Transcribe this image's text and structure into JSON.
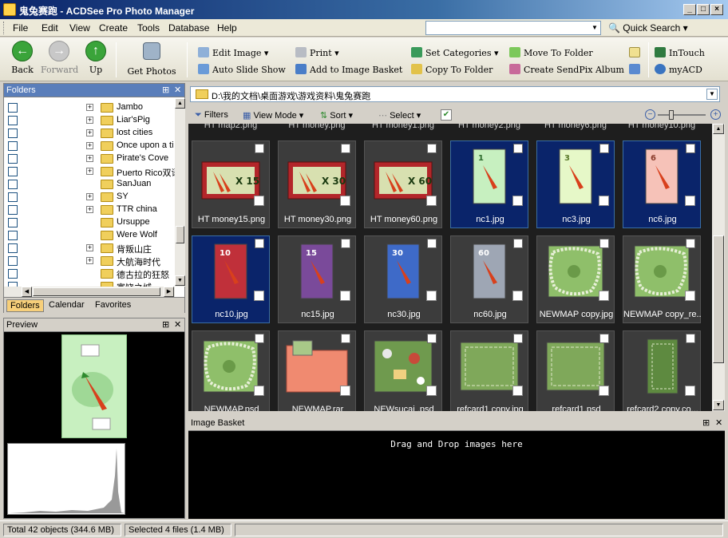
{
  "window": {
    "title": "鬼兔赛跑 - ACDSee Pro Photo Manager"
  },
  "menu": {
    "items": [
      "File",
      "Edit",
      "View",
      "Create",
      "Tools",
      "Database",
      "Help"
    ],
    "quick_search": "Quick Search"
  },
  "toolbar": {
    "back": "Back",
    "forward": "Forward",
    "up": "Up",
    "get_photos": "Get Photos",
    "edit_image": "Edit Image",
    "auto_slide_show": "Auto Slide Show",
    "print": "Print",
    "add_to_basket": "Add to Image Basket",
    "set_categories": "Set Categories",
    "copy_to_folder": "Copy To Folder",
    "move_to_folder": "Move To Folder",
    "create_sendpix": "Create SendPix Album",
    "intouch": "InTouch",
    "myacd": "myACD"
  },
  "folders": {
    "title": "Folders",
    "items": [
      {
        "name": "Jambo",
        "expander": true
      },
      {
        "name": "Liar'sPig",
        "expander": true
      },
      {
        "name": "lost cities",
        "expander": true
      },
      {
        "name": "Once upon a ti",
        "expander": true
      },
      {
        "name": "Pirate's Cove",
        "expander": true
      },
      {
        "name": "Puerto Rico双语",
        "expander": true
      },
      {
        "name": "SanJuan",
        "expander": false
      },
      {
        "name": "SY",
        "expander": true
      },
      {
        "name": "TTR china",
        "expander": true
      },
      {
        "name": "Ursuppe",
        "expander": false
      },
      {
        "name": "Were Wolf",
        "expander": false
      },
      {
        "name": "背叛山庄",
        "expander": true
      },
      {
        "name": "大航海时代",
        "expander": true
      },
      {
        "name": "德古拉的狂怒",
        "expander": false
      },
      {
        "name": "富饶之城",
        "expander": false
      }
    ],
    "tabs": [
      "Folders",
      "Calendar",
      "Favorites"
    ]
  },
  "preview": {
    "title": "Preview"
  },
  "address": {
    "path": "D:\\我的文档\\桌面游戏\\游戏资料\\鬼兔赛跑"
  },
  "browser_toolbar": {
    "filters": "Filters",
    "view_mode": "View Mode",
    "sort": "Sort",
    "select": "Select"
  },
  "files": {
    "partial_top": [
      "HT map2.png",
      "HT money.png",
      "HT money1.png",
      "HT money2.png",
      "HT money6.png",
      "HT money10.png"
    ],
    "rows": [
      [
        {
          "name": "HT money15.png",
          "kind": "money",
          "label": "X 15",
          "selected": false
        },
        {
          "name": "HT money30.png",
          "kind": "money",
          "label": "X 30",
          "selected": false
        },
        {
          "name": "HT money60.png",
          "kind": "money",
          "label": "X 60",
          "selected": false
        },
        {
          "name": "nc1.jpg",
          "kind": "card-green",
          "label": "1",
          "selected": true
        },
        {
          "name": "nc3.jpg",
          "kind": "card-lightgreen",
          "label": "3",
          "selected": true
        },
        {
          "name": "nc6.jpg",
          "kind": "card-pink",
          "label": "6",
          "selected": true
        }
      ],
      [
        {
          "name": "nc10.jpg",
          "kind": "card-red",
          "label": "10",
          "selected": true
        },
        {
          "name": "nc15.jpg",
          "kind": "card-purple",
          "label": "15",
          "selected": false
        },
        {
          "name": "nc30.jpg",
          "kind": "card-blue",
          "label": "30",
          "selected": false
        },
        {
          "name": "nc60.jpg",
          "kind": "card-grey",
          "label": "60",
          "selected": false
        },
        {
          "name": "NEWMAP copy.jpg",
          "kind": "map",
          "label": "",
          "selected": false
        },
        {
          "name": "NEWMAP copy_re...",
          "kind": "map",
          "label": "",
          "selected": false
        }
      ],
      [
        {
          "name": "NEWMAP.psd",
          "kind": "map",
          "label": "",
          "selected": false
        },
        {
          "name": "NEWMAP.rar",
          "kind": "folder",
          "label": "",
          "selected": false
        },
        {
          "name": "NEWsucai .psd",
          "kind": "sprites",
          "label": "",
          "selected": false
        },
        {
          "name": "refcard1 copy.jpg",
          "kind": "refcard",
          "label": "",
          "selected": false
        },
        {
          "name": "refcard1.psd",
          "kind": "refcard",
          "label": "",
          "selected": false
        },
        {
          "name": "refcard2 copy.co...",
          "kind": "refcard2",
          "label": "",
          "selected": false
        }
      ]
    ]
  },
  "basket": {
    "title": "Image Basket",
    "message": "Drag and Drop images here"
  },
  "status": {
    "total": "Total 42 objects  (344.6 MB)",
    "selected": "Selected 4 files (1.4 MB)"
  },
  "colors": {
    "titlebar": "#0a246a",
    "selection": "#0a246a",
    "grid_bg": "#1e1e1e",
    "thumb_bg": "#3c3c3c",
    "money_red": "#b3262a",
    "card_green": "#bff0b8"
  }
}
